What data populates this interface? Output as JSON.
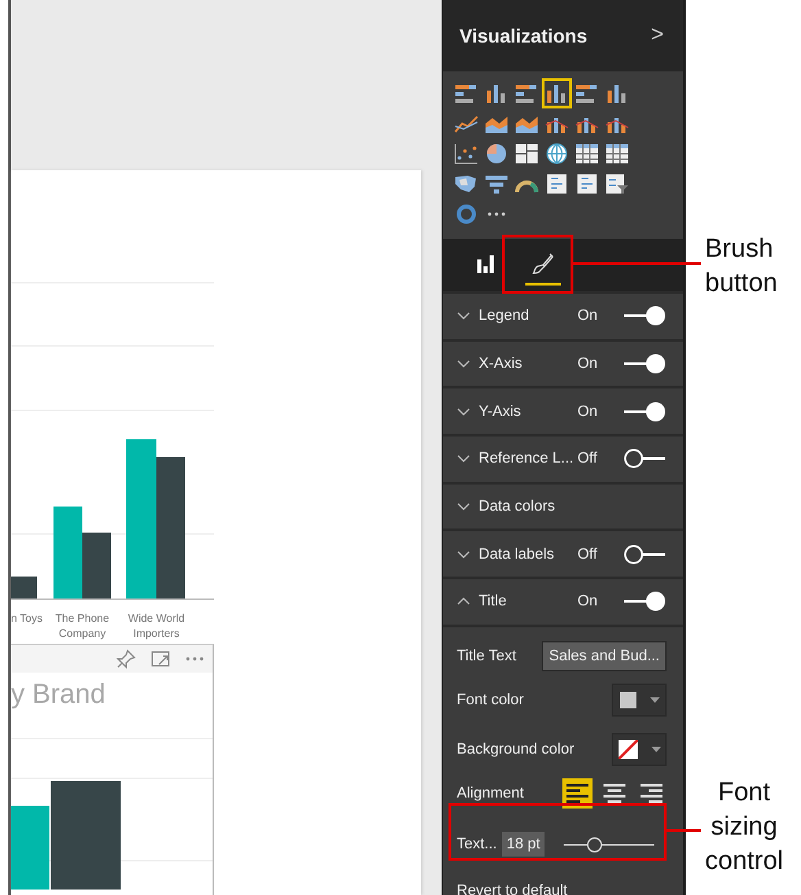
{
  "report": {
    "chart_1": {
      "x_labels": [
        "n Toys",
        "The Phone Company",
        "Wide World Importers"
      ]
    },
    "chart_2": {
      "title": "y Brand"
    }
  },
  "panel": {
    "title": "Visualizations",
    "expand_glyph": ">",
    "visuals": [
      {
        "kind": "hbar",
        "selected": false
      },
      {
        "kind": "vbar",
        "selected": false
      },
      {
        "kind": "hbar",
        "selected": false
      },
      {
        "kind": "vbar",
        "selected": true
      },
      {
        "kind": "hbar",
        "selected": false
      },
      {
        "kind": "vbar",
        "selected": false
      },
      {
        "kind": "line",
        "selected": false
      },
      {
        "kind": "area",
        "selected": false
      },
      {
        "kind": "area",
        "selected": false
      },
      {
        "kind": "combo",
        "selected": false
      },
      {
        "kind": "combo",
        "selected": false
      },
      {
        "kind": "combo",
        "selected": false
      },
      {
        "kind": "scatter",
        "selected": false
      },
      {
        "kind": "pie",
        "selected": false
      },
      {
        "kind": "treemap",
        "selected": false
      },
      {
        "kind": "globe",
        "selected": false
      },
      {
        "kind": "table",
        "selected": false
      },
      {
        "kind": "table",
        "selected": false
      },
      {
        "kind": "map",
        "selected": false
      },
      {
        "kind": "funnel",
        "selected": false
      },
      {
        "kind": "gauge",
        "selected": false
      },
      {
        "kind": "card",
        "selected": false
      },
      {
        "kind": "card",
        "selected": false
      },
      {
        "kind": "slicer",
        "selected": false
      },
      {
        "kind": "donut",
        "selected": false
      },
      {
        "kind": "more",
        "selected": false
      }
    ],
    "tabs": [
      {
        "kind": "fields",
        "selected": false
      },
      {
        "kind": "format",
        "selected": true
      }
    ],
    "sections": [
      {
        "label": "Legend",
        "kind": "toggle",
        "value": "On",
        "on": true,
        "expanded": false
      },
      {
        "label": "X-Axis",
        "kind": "toggle",
        "value": "On",
        "on": true,
        "expanded": false
      },
      {
        "label": "Y-Axis",
        "kind": "toggle",
        "value": "On",
        "on": true,
        "expanded": false
      },
      {
        "label": "Reference L...",
        "kind": "toggle",
        "value": "Off",
        "on": false,
        "expanded": false
      },
      {
        "label": "Data colors",
        "kind": "plain",
        "expanded": false
      },
      {
        "label": "Data labels",
        "kind": "toggle",
        "value": "Off",
        "on": false,
        "expanded": false
      },
      {
        "label": "Title",
        "kind": "toggle",
        "value": "On",
        "on": true,
        "expanded": true
      }
    ],
    "title_options": {
      "title_text": {
        "label": "Title Text",
        "value": "Sales and Bud..."
      },
      "font_color": {
        "label": "Font color",
        "color": "#c8c8c8"
      },
      "background_color": {
        "label": "Background color"
      },
      "alignment": {
        "label": "Alignment",
        "options": [
          {
            "kind": "left",
            "selected": true
          },
          {
            "kind": "center",
            "selected": false
          },
          {
            "kind": "right",
            "selected": false
          }
        ]
      },
      "text_size": {
        "label": "Text...",
        "value": "18 pt",
        "level": 0.34
      }
    },
    "revert": "Revert to default"
  },
  "callouts": [
    {
      "lines": [
        "Brush",
        "button"
      ]
    },
    {
      "lines": [
        "Font",
        "sizing",
        "control"
      ]
    }
  ]
}
